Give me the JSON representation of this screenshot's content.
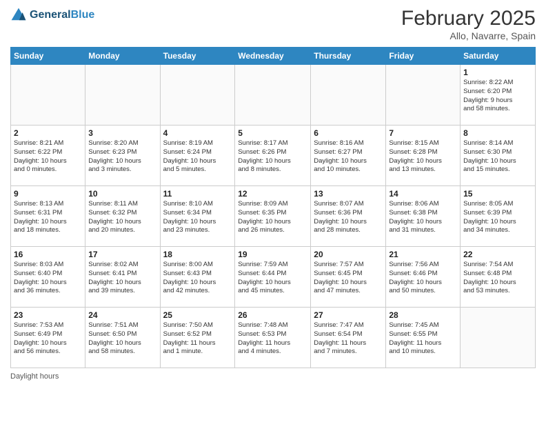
{
  "header": {
    "logo_line1": "General",
    "logo_line2": "Blue",
    "month_title": "February 2025",
    "location": "Allo, Navarre, Spain"
  },
  "days_of_week": [
    "Sunday",
    "Monday",
    "Tuesday",
    "Wednesday",
    "Thursday",
    "Friday",
    "Saturday"
  ],
  "weeks": [
    [
      {
        "day": "",
        "info": ""
      },
      {
        "day": "",
        "info": ""
      },
      {
        "day": "",
        "info": ""
      },
      {
        "day": "",
        "info": ""
      },
      {
        "day": "",
        "info": ""
      },
      {
        "day": "",
        "info": ""
      },
      {
        "day": "1",
        "info": "Sunrise: 8:22 AM\nSunset: 6:20 PM\nDaylight: 9 hours\nand 58 minutes."
      }
    ],
    [
      {
        "day": "2",
        "info": "Sunrise: 8:21 AM\nSunset: 6:22 PM\nDaylight: 10 hours\nand 0 minutes."
      },
      {
        "day": "3",
        "info": "Sunrise: 8:20 AM\nSunset: 6:23 PM\nDaylight: 10 hours\nand 3 minutes."
      },
      {
        "day": "4",
        "info": "Sunrise: 8:19 AM\nSunset: 6:24 PM\nDaylight: 10 hours\nand 5 minutes."
      },
      {
        "day": "5",
        "info": "Sunrise: 8:17 AM\nSunset: 6:26 PM\nDaylight: 10 hours\nand 8 minutes."
      },
      {
        "day": "6",
        "info": "Sunrise: 8:16 AM\nSunset: 6:27 PM\nDaylight: 10 hours\nand 10 minutes."
      },
      {
        "day": "7",
        "info": "Sunrise: 8:15 AM\nSunset: 6:28 PM\nDaylight: 10 hours\nand 13 minutes."
      },
      {
        "day": "8",
        "info": "Sunrise: 8:14 AM\nSunset: 6:30 PM\nDaylight: 10 hours\nand 15 minutes."
      }
    ],
    [
      {
        "day": "9",
        "info": "Sunrise: 8:13 AM\nSunset: 6:31 PM\nDaylight: 10 hours\nand 18 minutes."
      },
      {
        "day": "10",
        "info": "Sunrise: 8:11 AM\nSunset: 6:32 PM\nDaylight: 10 hours\nand 20 minutes."
      },
      {
        "day": "11",
        "info": "Sunrise: 8:10 AM\nSunset: 6:34 PM\nDaylight: 10 hours\nand 23 minutes."
      },
      {
        "day": "12",
        "info": "Sunrise: 8:09 AM\nSunset: 6:35 PM\nDaylight: 10 hours\nand 26 minutes."
      },
      {
        "day": "13",
        "info": "Sunrise: 8:07 AM\nSunset: 6:36 PM\nDaylight: 10 hours\nand 28 minutes."
      },
      {
        "day": "14",
        "info": "Sunrise: 8:06 AM\nSunset: 6:38 PM\nDaylight: 10 hours\nand 31 minutes."
      },
      {
        "day": "15",
        "info": "Sunrise: 8:05 AM\nSunset: 6:39 PM\nDaylight: 10 hours\nand 34 minutes."
      }
    ],
    [
      {
        "day": "16",
        "info": "Sunrise: 8:03 AM\nSunset: 6:40 PM\nDaylight: 10 hours\nand 36 minutes."
      },
      {
        "day": "17",
        "info": "Sunrise: 8:02 AM\nSunset: 6:41 PM\nDaylight: 10 hours\nand 39 minutes."
      },
      {
        "day": "18",
        "info": "Sunrise: 8:00 AM\nSunset: 6:43 PM\nDaylight: 10 hours\nand 42 minutes."
      },
      {
        "day": "19",
        "info": "Sunrise: 7:59 AM\nSunset: 6:44 PM\nDaylight: 10 hours\nand 45 minutes."
      },
      {
        "day": "20",
        "info": "Sunrise: 7:57 AM\nSunset: 6:45 PM\nDaylight: 10 hours\nand 47 minutes."
      },
      {
        "day": "21",
        "info": "Sunrise: 7:56 AM\nSunset: 6:46 PM\nDaylight: 10 hours\nand 50 minutes."
      },
      {
        "day": "22",
        "info": "Sunrise: 7:54 AM\nSunset: 6:48 PM\nDaylight: 10 hours\nand 53 minutes."
      }
    ],
    [
      {
        "day": "23",
        "info": "Sunrise: 7:53 AM\nSunset: 6:49 PM\nDaylight: 10 hours\nand 56 minutes."
      },
      {
        "day": "24",
        "info": "Sunrise: 7:51 AM\nSunset: 6:50 PM\nDaylight: 10 hours\nand 58 minutes."
      },
      {
        "day": "25",
        "info": "Sunrise: 7:50 AM\nSunset: 6:52 PM\nDaylight: 11 hours\nand 1 minute."
      },
      {
        "day": "26",
        "info": "Sunrise: 7:48 AM\nSunset: 6:53 PM\nDaylight: 11 hours\nand 4 minutes."
      },
      {
        "day": "27",
        "info": "Sunrise: 7:47 AM\nSunset: 6:54 PM\nDaylight: 11 hours\nand 7 minutes."
      },
      {
        "day": "28",
        "info": "Sunrise: 7:45 AM\nSunset: 6:55 PM\nDaylight: 11 hours\nand 10 minutes."
      },
      {
        "day": "",
        "info": ""
      }
    ]
  ],
  "footer": {
    "text": "Daylight hours"
  }
}
